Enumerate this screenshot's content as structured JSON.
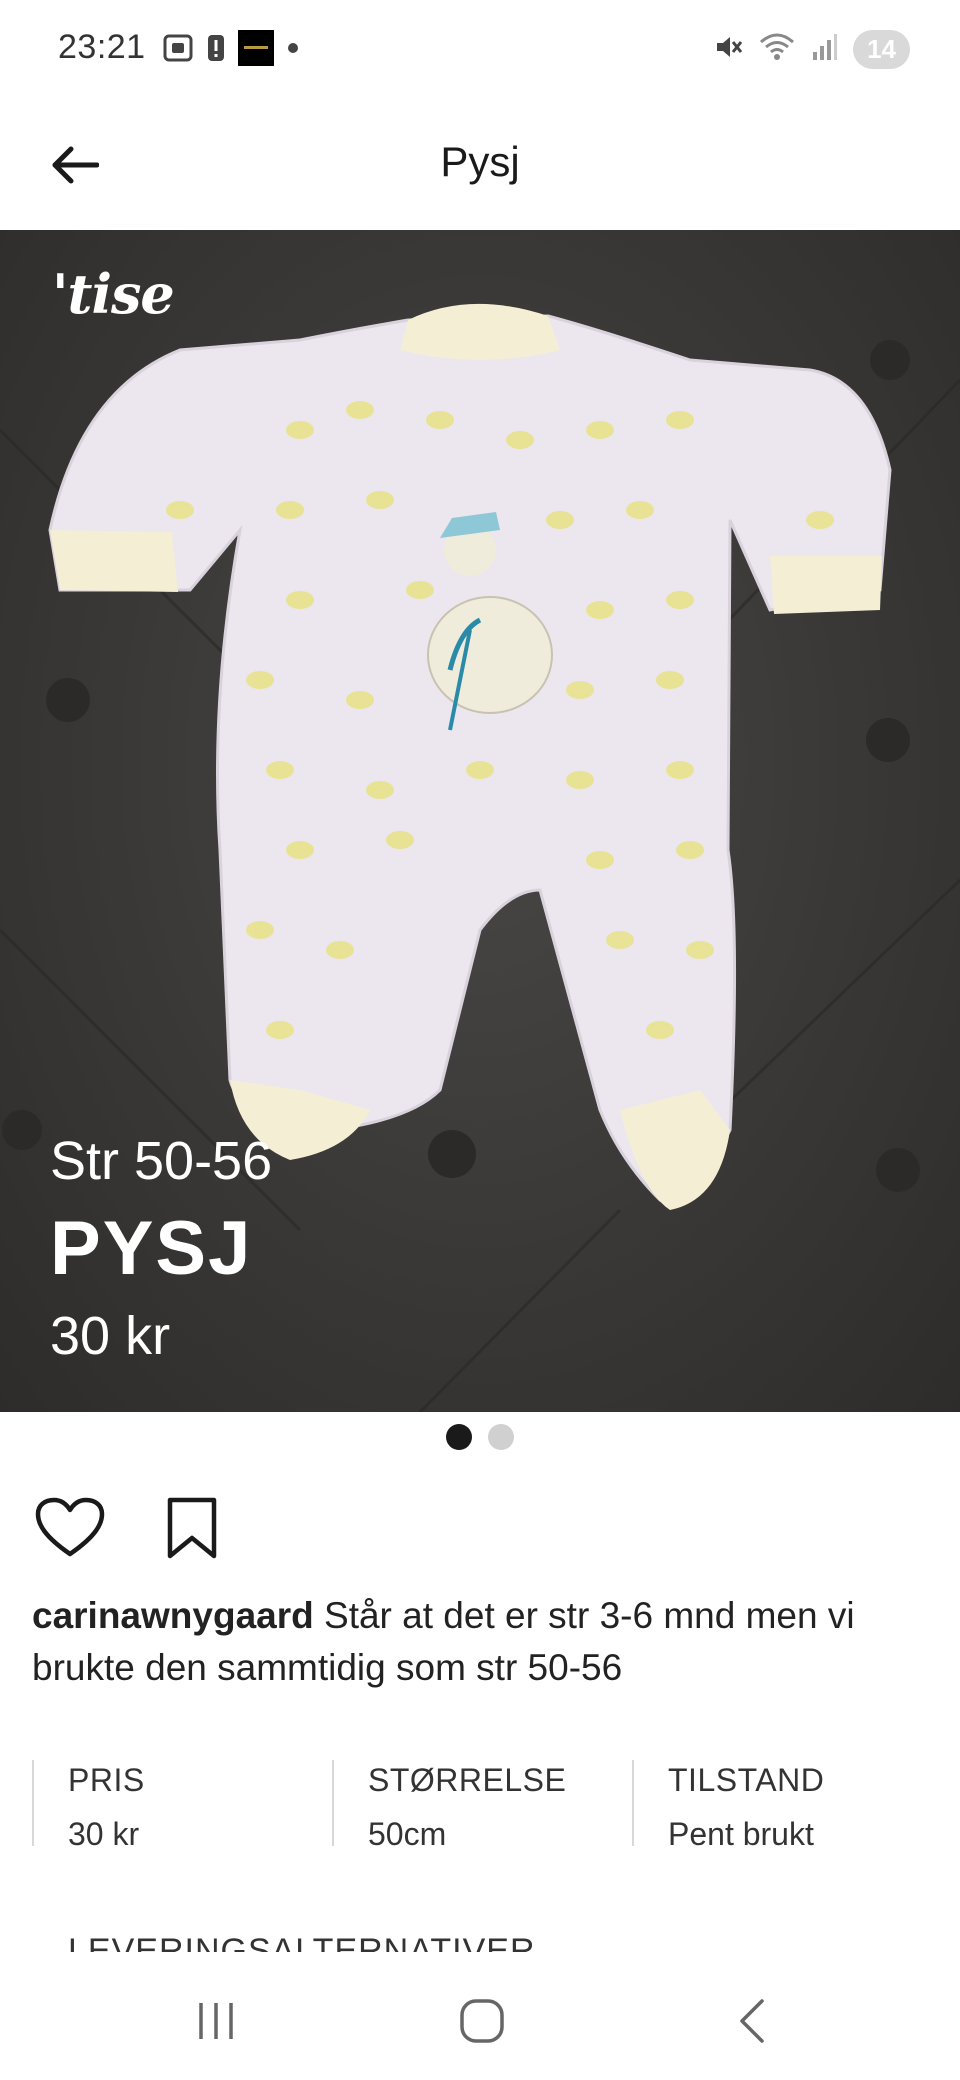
{
  "status_bar": {
    "time": "23:21",
    "notification_badge": "14",
    "left_icons": [
      "screenshot-icon",
      "alert-icon",
      "app-thumbnail-icon",
      "dot-icon"
    ],
    "right_icons": [
      "mute-icon",
      "wifi-icon",
      "signal-icon"
    ]
  },
  "header": {
    "title": "Pysj",
    "back_icon": "arrow-left-icon"
  },
  "product_image": {
    "logo": "'tise",
    "size_text": "Str 50-56",
    "title_text": "PYSJ",
    "price_text": "30 kr",
    "carousel": {
      "count": 2,
      "active_index": 0
    }
  },
  "actions": {
    "like_icon": "heart-outline-icon",
    "save_icon": "bookmark-outline-icon"
  },
  "description": {
    "username": "carinawnygaard",
    "text": " Står at det er str 3-6 mnd men vi brukte den sammtidig som str 50-56"
  },
  "info": [
    {
      "label": "PRIS",
      "value": "30 kr"
    },
    {
      "label": "STØRRELSE",
      "value": "50cm"
    },
    {
      "label": "TILSTAND",
      "value": "Pent brukt"
    }
  ],
  "delivery": {
    "label": "LEVERINGSALTERNATIVER"
  },
  "nav_bar": {
    "icons": [
      "recent-apps-icon",
      "home-icon",
      "back-icon"
    ]
  },
  "colors": {
    "text": "#1a1a1a",
    "background": "#ffffff",
    "photo_background": "#3a3836",
    "dot_active": "#1a1a1a",
    "dot_inactive": "#d0d0d0"
  }
}
